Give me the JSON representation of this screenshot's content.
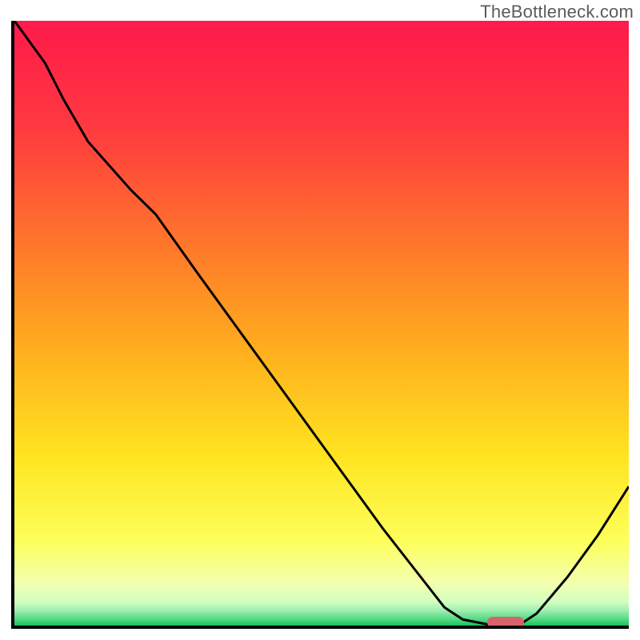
{
  "watermark": "TheBottleneck.com",
  "chart_data": {
    "type": "line",
    "title": "",
    "xlabel": "",
    "ylabel": "",
    "x": [
      0.0,
      0.05,
      0.08,
      0.12,
      0.19,
      0.23,
      0.3,
      0.4,
      0.5,
      0.6,
      0.7,
      0.73,
      0.78,
      0.82,
      0.85,
      0.9,
      0.95,
      1.0
    ],
    "y": [
      1.0,
      0.93,
      0.87,
      0.8,
      0.72,
      0.68,
      0.58,
      0.44,
      0.3,
      0.16,
      0.03,
      0.01,
      0.0,
      0.0,
      0.02,
      0.08,
      0.15,
      0.23
    ],
    "xlim": [
      0,
      1
    ],
    "ylim": [
      0,
      1
    ],
    "marker": {
      "x": 0.8,
      "y": 0.005
    },
    "gradient_stops": [
      {
        "pos": 0.0,
        "color": "#ff1a4b"
      },
      {
        "pos": 0.18,
        "color": "#ff3a3f"
      },
      {
        "pos": 0.38,
        "color": "#ff7a2a"
      },
      {
        "pos": 0.55,
        "color": "#ffb01e"
      },
      {
        "pos": 0.72,
        "color": "#ffe420"
      },
      {
        "pos": 0.86,
        "color": "#fdff5a"
      },
      {
        "pos": 0.93,
        "color": "#f3ffb0"
      },
      {
        "pos": 0.96,
        "color": "#d4ffc0"
      },
      {
        "pos": 0.975,
        "color": "#9fefb0"
      },
      {
        "pos": 0.99,
        "color": "#4fd980"
      },
      {
        "pos": 1.0,
        "color": "#17c455"
      }
    ],
    "marker_color": "#d9626d"
  }
}
